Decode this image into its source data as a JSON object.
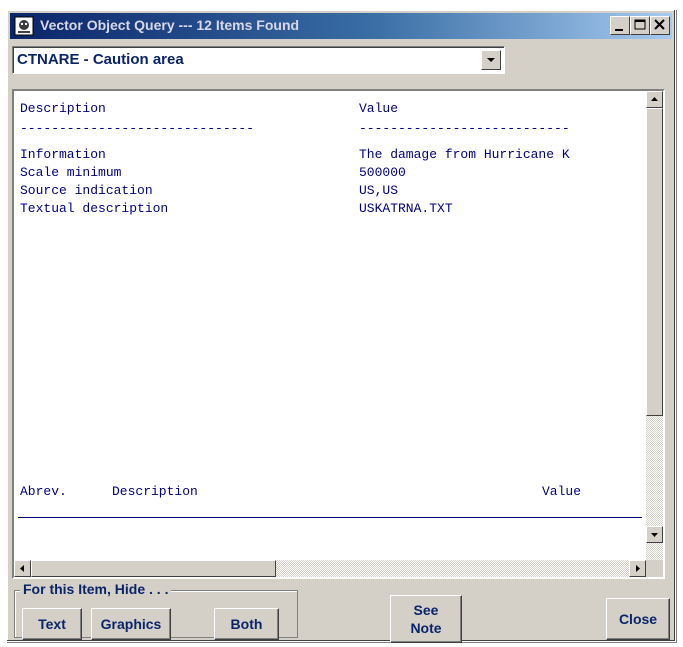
{
  "window": {
    "title": "Vector Object Query --- 12 Items Found"
  },
  "combo": {
    "selected": "CTNARE - Caution area"
  },
  "attributes": {
    "header_description": "Description",
    "header_value": "Value",
    "separator_left": "------------------------------",
    "separator_right": "---------------------------",
    "rows": [
      {
        "description": "Information",
        "value": "The damage from Hurricane K"
      },
      {
        "description": "Scale minimum",
        "value": "500000"
      },
      {
        "description": "Source indication",
        "value": "US,US"
      },
      {
        "description": "Textual description",
        "value": "USKATRNA.TXT"
      }
    ]
  },
  "abbrev_table": {
    "col_abrev": "Abrev.",
    "col_description": "Description",
    "col_value": "Value"
  },
  "hide_group": {
    "legend": "For this Item, Hide . . .",
    "text_label": "Text",
    "graphics_label": "Graphics",
    "both_label": "Both"
  },
  "see_note": {
    "line1": "See",
    "line2": "Note"
  },
  "close_label": "Close",
  "colors": {
    "title_start": "#0a246a",
    "text_accent": "#000080",
    "face": "#d4d0c8"
  }
}
